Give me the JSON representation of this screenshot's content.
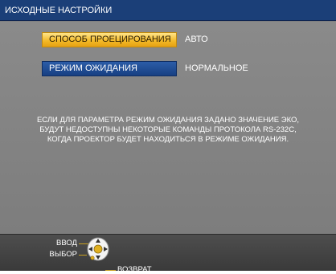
{
  "menu": {
    "title": "ИСХОДНЫЕ НАСТРОЙКИ",
    "items": [
      {
        "label": "СПОСОБ ПРОЕЦИРОВАНИЯ",
        "value": "АВТО",
        "selected": true
      },
      {
        "label": "РЕЖИМ ОЖИДАНИЯ",
        "value": "НОРМАЛЬНОЕ",
        "selected": false
      }
    ],
    "note_lines": [
      "ЕСЛИ ДЛЯ ПАРАМЕТРА РЕЖИМ ОЖИДАНИЯ ЗАДАНО ЗНАЧЕНИЕ ЭКО,",
      "БУДУТ НЕДОСТУПНЫ НЕКОТОРЫЕ КОМАНДЫ ПРОТОКОЛА RS-232C,",
      "КОГДА ПРОЕКТОР БУДЕТ НАХОДИТЬСЯ В РЕЖИМЕ ОЖИДАНИЯ."
    ]
  },
  "controls": {
    "enter_label": "ВВОД",
    "select_label": "ВЫБОР",
    "back_label": "ВОЗВРАТ",
    "dpad_icon": "dpad-icon"
  },
  "colors": {
    "title_bar": "#1b3f78",
    "menu_background": "#7f7f7f",
    "selected_item": "#f2b826",
    "normal_item": "#1f4a90",
    "bottom_bar": "#444444"
  }
}
